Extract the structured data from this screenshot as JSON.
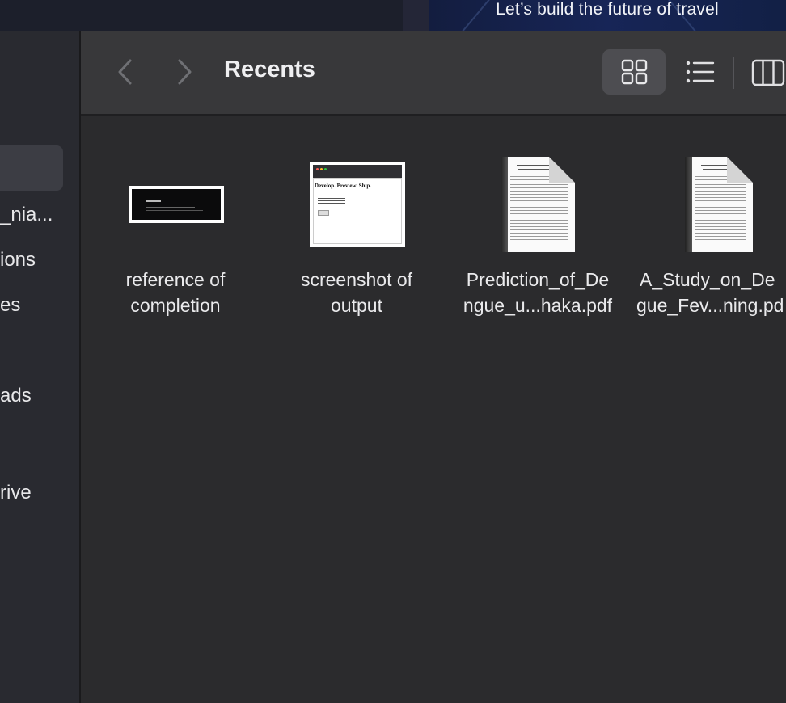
{
  "banner": {
    "text": "Let’s build the future of travel"
  },
  "sidebar": {
    "items": [
      {
        "label": "_nia..."
      },
      {
        "label": "ions"
      },
      {
        "label": "es"
      },
      {
        "label": "ads"
      },
      {
        "label": "rive"
      }
    ]
  },
  "toolbar": {
    "title": "Recents",
    "back_icon": "chevron-left-icon",
    "forward_icon": "chevron-right-icon",
    "views": [
      "grid-view-icon",
      "list-view-icon",
      "column-view-icon"
    ],
    "active_view": "grid-view-icon"
  },
  "files": [
    {
      "line1": "reference of",
      "line2": "completion"
    },
    {
      "line1": "screenshot of",
      "line2": "output",
      "thumb_heading": "Develop. Preview. Ship."
    },
    {
      "line1": "Prediction_of_De",
      "line2": "ngue_u...haka.pdf"
    },
    {
      "line1": "A_Study_on_De",
      "line2": "gue_Fev...ning.pd"
    }
  ]
}
